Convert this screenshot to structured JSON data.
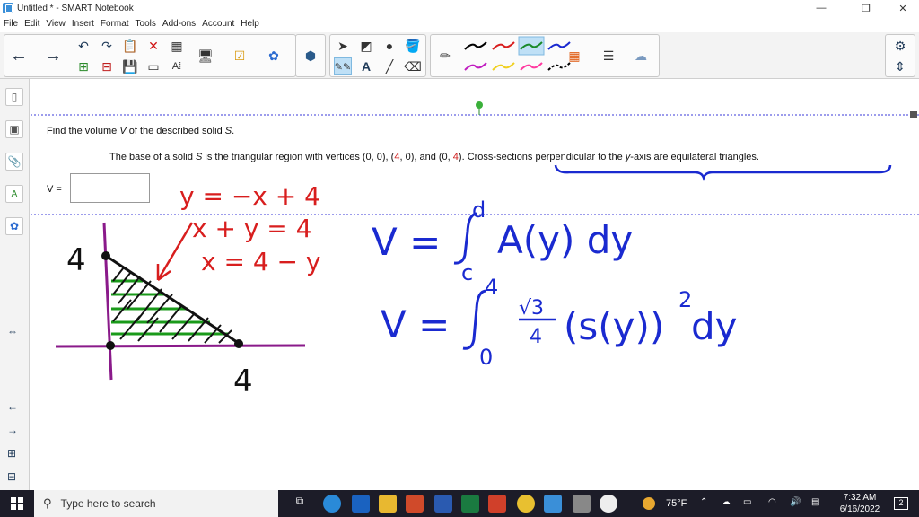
{
  "window": {
    "title": "Untitled * - SMART Notebook",
    "controls": [
      "—",
      "❐",
      "✕"
    ]
  },
  "menu": [
    "File",
    "Edit",
    "View",
    "Insert",
    "Format",
    "Tools",
    "Add-ons",
    "Account",
    "Help"
  ],
  "toolbar": {
    "tools": [
      "back-icon",
      "forward-icon",
      "undo-icon",
      "redo-icon",
      "paste-icon",
      "delete-icon",
      "table-icon",
      "add-page-icon",
      "remove-page-icon",
      "save-icon",
      "screen-shade-icon",
      "text-recognition-icon",
      "document-camera-icon",
      "check-icon",
      "addon-icon",
      "lab-icon",
      "select-icon",
      "shapes-icon",
      "fill-icon",
      "paint-icon",
      "text-icon",
      "line-icon",
      "eraser-icon",
      "pen-icon",
      "settings-icon"
    ],
    "pen_colors": [
      "#000000",
      "#d81e1e",
      "#1a8a2a",
      "#1a2ad0",
      "#c01cc0",
      "#f0d020",
      "#ff3aa0",
      "#000000"
    ]
  },
  "question": {
    "prompt_pre": "Find the volume ",
    "prompt_var": "V",
    "prompt_mid": " of the described solid ",
    "prompt_solid": "S",
    "prompt_end": ".",
    "base_pre": "The base of a solid ",
    "base_s": "S",
    "base_mid": " is the triangular region with vertices (0, 0), (",
    "v1": "4",
    "base_mid2": ", 0), and (0, ",
    "v2": "4",
    "base_mid3": "). ",
    "cross": "Cross-sections perpendicular to the ",
    "cross_var": "y",
    "cross_end": "-axis are equilateral triangles.",
    "answer_label": "V ="
  },
  "handwriting": {
    "eq1": "y = −x + 4",
    "eq2": "x + y = 4",
    "eq3": "x = 4 − y",
    "axis_y_label": "4",
    "axis_x_label": "4",
    "formula1_lhs": "V =",
    "formula1_upper": "d",
    "formula1_lower": "c",
    "formula1_integrand": "A(y) dy",
    "formula2_lhs": "V =",
    "formula2_upper": "4",
    "formula2_lower": "0",
    "formula2_coef_num": "√3",
    "formula2_coef_den": "4",
    "formula2_integrand": "(s(y))",
    "formula2_power": "2",
    "formula2_dy": "dy"
  },
  "taskbar": {
    "search_placeholder": "Type here to search",
    "weather": "75°F",
    "time": "7:32 AM",
    "date": "6/16/2022",
    "notifications": "2"
  }
}
